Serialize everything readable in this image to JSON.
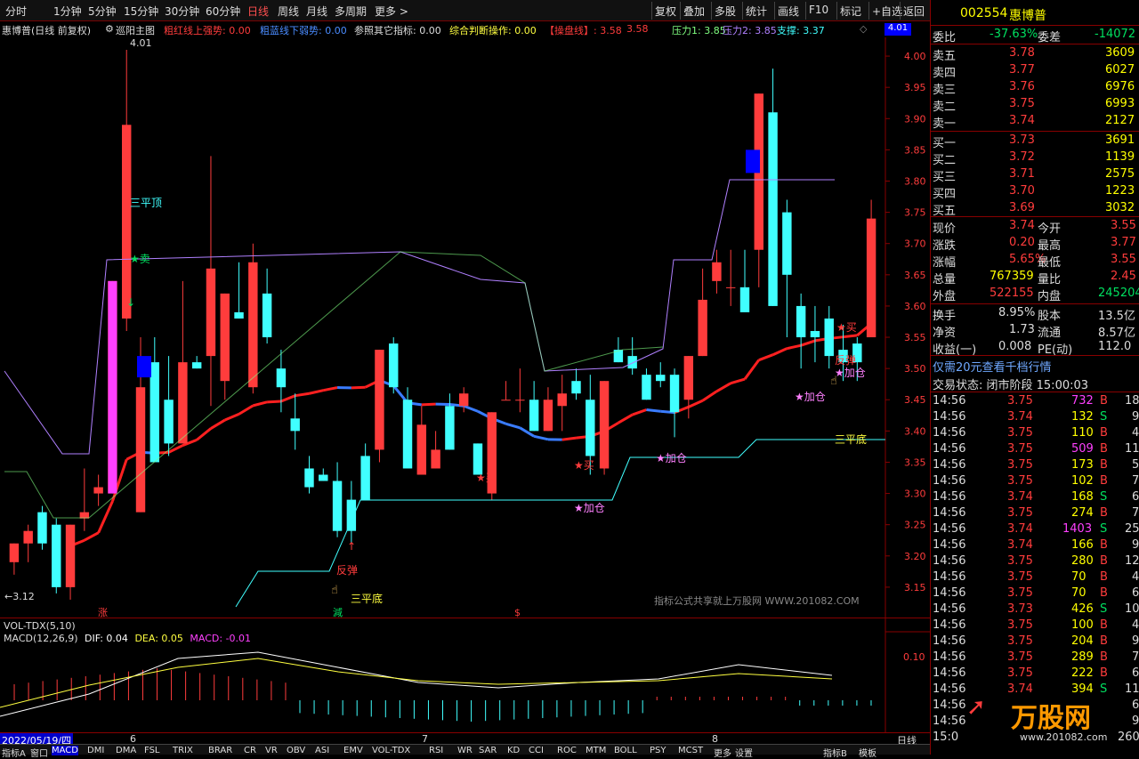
{
  "toolbar": {
    "left_items": [
      "分时",
      "1分钟",
      "5分钟",
      "15分钟",
      "30分钟",
      "60分钟",
      "日线",
      "周线",
      "月线",
      "多周期",
      "更多 >"
    ],
    "active_index": 6,
    "right_items": [
      "复权",
      "叠加",
      "多股",
      "统计",
      "画线",
      "F10",
      "标记",
      "+自选",
      "返回"
    ]
  },
  "indicator_bar": {
    "title": "惠博普(日线 前复权)",
    "main_indicator": "巡阳主图",
    "items": [
      {
        "text": "粗红线上强势: 0.00",
        "color": "#ff3c3c"
      },
      {
        "text": "粗蓝线下弱势: 0.00",
        "color": "#4a8cff"
      },
      {
        "text": "参照其它指标: 0.00",
        "color": "#dddddd"
      },
      {
        "text": "综合判断操作: 0.00",
        "color": "#ffff40"
      },
      {
        "text": "【操盘线】: 3.58",
        "color": "#ff3c3c"
      },
      {
        "text": "3.58",
        "color": "#ff3c3c"
      },
      {
        "text": "压力1: 3.85",
        "color": "#80ff80"
      },
      {
        "text": "压力2: 3.85",
        "color": "#b080ff"
      },
      {
        "text": "支撑: 3.37",
        "color": "#40ffff"
      }
    ],
    "diamond": "◇",
    "price_box": "4.01"
  },
  "price_axis": {
    "labels": [
      "4.00",
      "3.95",
      "3.90",
      "3.85",
      "3.80",
      "3.75",
      "3.70",
      "3.65",
      "3.60",
      "3.55",
      "3.50",
      "3.45",
      "3.40",
      "3.35",
      "3.30",
      "3.25",
      "3.20",
      "3.15"
    ]
  },
  "chart_annotations": {
    "high_label": "4.01",
    "low_label": "←3.12",
    "top3": "三平顶",
    "bottom3_a": "三平底",
    "bottom3_b": "三平底",
    "sell": "★卖",
    "rebound_a": "反弹",
    "rebound_b": "反弹",
    "buy_1": "★买",
    "buy_2": "★买",
    "buy_3": "★买",
    "add_1": "★加仓",
    "add_2": "★加仓",
    "add_3": "★加仓",
    "add_4": "★加仓",
    "watermark": "指标公式共享就上万股网 WWW.201082.COM",
    "mark_zhang": "涨",
    "mark_jian": "減",
    "mark_s": "$"
  },
  "sub_panel": {
    "line1": "VOL-TDX(5,10)",
    "line2_name": "MACD(12,26,9)",
    "dif": "DIF: 0.04",
    "dea": "DEA: 0.05",
    "macd": "MACD: -0.01",
    "axis_label": "0.10"
  },
  "date_axis": {
    "start_date": "2022/05/19/四",
    "months": [
      "6",
      "7",
      "8"
    ],
    "period_label": "日线"
  },
  "bottom_tabs": [
    "指标A",
    "窗口",
    "MACD",
    "DMI",
    "DMA",
    "FSL",
    "TRIX",
    "BRAR",
    "CR",
    "VR",
    "OBV",
    "ASI",
    "EMV",
    "VOL-TDX",
    "RSI",
    "WR",
    "SAR",
    "KD",
    "CCI",
    "ROC",
    "MTM",
    "BOLL",
    "PSY",
    "MCST",
    "更多",
    "设置"
  ],
  "bottom_tabs_right": [
    "指标B",
    "模板"
  ],
  "quote": {
    "code": "002554",
    "name": "惠博普",
    "weibi_label": "委比",
    "weibi": "-37.63%",
    "weicha_label": "委差",
    "weicha": "-14072",
    "asks": [
      {
        "label": "卖五",
        "price": "3.78",
        "vol": "3609"
      },
      {
        "label": "卖四",
        "price": "3.77",
        "vol": "6027"
      },
      {
        "label": "卖三",
        "price": "3.76",
        "vol": "6976"
      },
      {
        "label": "卖二",
        "price": "3.75",
        "vol": "6993"
      },
      {
        "label": "卖一",
        "price": "3.74",
        "vol": "2127"
      }
    ],
    "bids": [
      {
        "label": "买一",
        "price": "3.73",
        "vol": "3691"
      },
      {
        "label": "买二",
        "price": "3.72",
        "vol": "1139"
      },
      {
        "label": "买三",
        "price": "3.71",
        "vol": "2575"
      },
      {
        "label": "买四",
        "price": "3.70",
        "vol": "1223"
      },
      {
        "label": "买五",
        "price": "3.69",
        "vol": "3032"
      }
    ],
    "stats": [
      {
        "l1": "现价",
        "v1": "3.74",
        "c1": "red",
        "l2": "今开",
        "v2": "3.55",
        "c2": "red"
      },
      {
        "l1": "涨跌",
        "v1": "0.20",
        "c1": "red",
        "l2": "最高",
        "v2": "3.77",
        "c2": "red"
      },
      {
        "l1": "涨幅",
        "v1": "5.65%",
        "c1": "red",
        "l2": "最低",
        "v2": "3.55",
        "c2": "red"
      },
      {
        "l1": "总量",
        "v1": "767359",
        "c1": "yellow",
        "l2": "量比",
        "v2": "2.45",
        "c2": "red"
      },
      {
        "l1": "外盘",
        "v1": "522155",
        "c1": "red",
        "l2": "内盘",
        "v2": "245204",
        "c2": "green"
      }
    ],
    "stats2": [
      {
        "l1": "换手",
        "v1": "8.95%",
        "l2": "股本",
        "v2": "13.5亿"
      },
      {
        "l1": "净资",
        "v1": "1.73",
        "l2": "流通",
        "v2": "8.57亿"
      },
      {
        "l1": "收益(一)",
        "v1": "0.008",
        "l2": "PE(动)",
        "v2": "112.0"
      }
    ],
    "promo": "仅需20元查看千档行情",
    "trade_status": "交易状态: 闭市阶段 15:00:03",
    "ticks": [
      {
        "t": "14:56",
        "p": "3.75",
        "v": "732",
        "bs": "B",
        "n": "18",
        "vc": "mag"
      },
      {
        "t": "14:56",
        "p": "3.74",
        "v": "132",
        "bs": "S",
        "n": "9",
        "vc": "yellow"
      },
      {
        "t": "14:56",
        "p": "3.75",
        "v": "110",
        "bs": "B",
        "n": "4",
        "vc": "yellow"
      },
      {
        "t": "14:56",
        "p": "3.75",
        "v": "509",
        "bs": "B",
        "n": "11",
        "vc": "mag"
      },
      {
        "t": "14:56",
        "p": "3.75",
        "v": "173",
        "bs": "B",
        "n": "5",
        "vc": "yellow"
      },
      {
        "t": "14:56",
        "p": "3.75",
        "v": "102",
        "bs": "B",
        "n": "7",
        "vc": "yellow"
      },
      {
        "t": "14:56",
        "p": "3.74",
        "v": "168",
        "bs": "S",
        "n": "6",
        "vc": "yellow"
      },
      {
        "t": "14:56",
        "p": "3.75",
        "v": "274",
        "bs": "B",
        "n": "7",
        "vc": "yellow"
      },
      {
        "t": "14:56",
        "p": "3.74",
        "v": "1403",
        "bs": "S",
        "n": "25",
        "vc": "mag"
      },
      {
        "t": "14:56",
        "p": "3.74",
        "v": "166",
        "bs": "B",
        "n": "9",
        "vc": "yellow"
      },
      {
        "t": "14:56",
        "p": "3.75",
        "v": "280",
        "bs": "B",
        "n": "12",
        "vc": "yellow"
      },
      {
        "t": "14:56",
        "p": "3.75",
        "v": "70",
        "bs": "B",
        "n": "4",
        "vc": "yellow"
      },
      {
        "t": "14:56",
        "p": "3.75",
        "v": "70",
        "bs": "B",
        "n": "6",
        "vc": "yellow"
      },
      {
        "t": "14:56",
        "p": "3.73",
        "v": "426",
        "bs": "S",
        "n": "10",
        "vc": "yellow"
      },
      {
        "t": "14:56",
        "p": "3.75",
        "v": "100",
        "bs": "B",
        "n": "4",
        "vc": "yellow"
      },
      {
        "t": "14:56",
        "p": "3.75",
        "v": "204",
        "bs": "B",
        "n": "9",
        "vc": "yellow"
      },
      {
        "t": "14:56",
        "p": "3.75",
        "v": "289",
        "bs": "B",
        "n": "7",
        "vc": "yellow"
      },
      {
        "t": "14:56",
        "p": "3.75",
        "v": "222",
        "bs": "B",
        "n": "6",
        "vc": "yellow"
      },
      {
        "t": "14:56",
        "p": "3.74",
        "v": "394",
        "bs": "S",
        "n": "11",
        "vc": "yellow"
      },
      {
        "t": "14:56",
        "p": "",
        "v": "",
        "bs": "",
        "n": "6",
        "vc": "yellow"
      },
      {
        "t": "14:56",
        "p": "",
        "v": "",
        "bs": "",
        "n": "9",
        "vc": "yellow"
      },
      {
        "t": "15:0",
        "p": "",
        "v": "",
        "bs": "",
        "n": "260",
        "vc": "yellow"
      }
    ],
    "logo_text": "万股网",
    "logo_url": "www.201082.com"
  },
  "colors": {
    "up": "#ff3c3c",
    "down": "#40ffff",
    "ma_up": "#ff2020",
    "ma_down": "#3a7cff",
    "accent_red": "#ff3c3c",
    "green": "#00e060",
    "yellow": "#ffff00"
  },
  "chart_data": {
    "type": "candlestick",
    "ylim": [
      3.1,
      4.03
    ],
    "candles": [
      {
        "o": 3.19,
        "h": 3.22,
        "l": 3.17,
        "c": 3.22
      },
      {
        "o": 3.22,
        "h": 3.25,
        "l": 3.19,
        "c": 3.24
      },
      {
        "o": 3.27,
        "h": 3.28,
        "l": 3.21,
        "c": 3.22
      },
      {
        "o": 3.25,
        "h": 3.26,
        "l": 3.14,
        "c": 3.15
      },
      {
        "o": 3.15,
        "h": 3.25,
        "l": 3.13,
        "c": 3.25
      },
      {
        "o": 3.26,
        "h": 3.34,
        "l": 3.24,
        "c": 3.27
      },
      {
        "o": 3.3,
        "h": 3.33,
        "l": 3.28,
        "c": 3.31
      },
      {
        "o": 3.3,
        "h": 3.64,
        "l": 3.3,
        "c": 3.64
      },
      {
        "o": 3.58,
        "h": 4.01,
        "l": 3.56,
        "c": 3.89
      },
      {
        "o": 3.27,
        "h": 3.55,
        "l": 3.27,
        "c": 3.47
      },
      {
        "o": 3.51,
        "h": 3.55,
        "l": 3.35,
        "c": 3.35
      },
      {
        "o": 3.45,
        "h": 3.52,
        "l": 3.36,
        "c": 3.38
      },
      {
        "o": 3.38,
        "h": 3.64,
        "l": 3.38,
        "c": 3.51
      },
      {
        "o": 3.51,
        "h": 3.52,
        "l": 3.5,
        "c": 3.5
      },
      {
        "o": 3.52,
        "h": 3.84,
        "l": 3.44,
        "c": 3.66
      },
      {
        "o": 3.48,
        "h": 3.62,
        "l": 3.45,
        "c": 3.62
      },
      {
        "o": 3.59,
        "h": 3.67,
        "l": 3.58,
        "c": 3.58
      },
      {
        "o": 3.47,
        "h": 3.7,
        "l": 3.46,
        "c": 3.67
      },
      {
        "o": 3.62,
        "h": 3.66,
        "l": 3.54,
        "c": 3.55
      },
      {
        "o": 3.5,
        "h": 3.53,
        "l": 3.43,
        "c": 3.47
      },
      {
        "o": 3.42,
        "h": 3.46,
        "l": 3.37,
        "c": 3.4
      },
      {
        "o": 3.34,
        "h": 3.36,
        "l": 3.3,
        "c": 3.31
      },
      {
        "o": 3.33,
        "h": 3.34,
        "l": 3.32,
        "c": 3.32
      },
      {
        "o": 3.32,
        "h": 3.35,
        "l": 3.23,
        "c": 3.24
      },
      {
        "o": 3.29,
        "h": 3.32,
        "l": 3.22,
        "c": 3.24
      },
      {
        "o": 3.36,
        "h": 3.38,
        "l": 3.29,
        "c": 3.29
      },
      {
        "o": 3.37,
        "h": 3.53,
        "l": 3.35,
        "c": 3.53
      },
      {
        "o": 3.54,
        "h": 3.55,
        "l": 3.46,
        "c": 3.47
      },
      {
        "o": 3.45,
        "h": 3.47,
        "l": 3.34,
        "c": 3.34
      },
      {
        "o": 3.33,
        "h": 3.44,
        "l": 3.33,
        "c": 3.41
      },
      {
        "o": 3.34,
        "h": 3.4,
        "l": 3.34,
        "c": 3.37
      },
      {
        "o": 3.44,
        "h": 3.46,
        "l": 3.37,
        "c": 3.37
      },
      {
        "o": 3.44,
        "h": 3.47,
        "l": 3.43,
        "c": 3.46
      },
      {
        "o": 3.38,
        "h": 3.38,
        "l": 3.33,
        "c": 3.33
      },
      {
        "o": 3.3,
        "h": 3.43,
        "l": 3.29,
        "c": 3.43
      },
      {
        "o": 3.45,
        "h": 3.48,
        "l": 3.45,
        "c": 3.45
      },
      {
        "o": 3.45,
        "h": 3.5,
        "l": 3.43,
        "c": 3.45
      },
      {
        "o": 3.45,
        "h": 3.48,
        "l": 3.4,
        "c": 3.4
      },
      {
        "o": 3.4,
        "h": 3.47,
        "l": 3.4,
        "c": 3.45
      },
      {
        "o": 3.44,
        "h": 3.49,
        "l": 3.4,
        "c": 3.46
      },
      {
        "o": 3.48,
        "h": 3.5,
        "l": 3.45,
        "c": 3.46
      },
      {
        "o": 3.45,
        "h": 3.49,
        "l": 3.33,
        "c": 3.36
      },
      {
        "o": 3.34,
        "h": 3.48,
        "l": 3.33,
        "c": 3.48
      },
      {
        "o": 3.53,
        "h": 3.55,
        "l": 3.51,
        "c": 3.51
      },
      {
        "o": 3.52,
        "h": 3.55,
        "l": 3.49,
        "c": 3.5
      },
      {
        "o": 3.49,
        "h": 3.5,
        "l": 3.45,
        "c": 3.45
      },
      {
        "o": 3.49,
        "h": 3.51,
        "l": 3.47,
        "c": 3.48
      },
      {
        "o": 3.49,
        "h": 3.5,
        "l": 3.39,
        "c": 3.43
      },
      {
        "o": 3.45,
        "h": 3.52,
        "l": 3.42,
        "c": 3.52
      },
      {
        "o": 3.52,
        "h": 3.66,
        "l": 3.52,
        "c": 3.61
      },
      {
        "o": 3.64,
        "h": 3.69,
        "l": 3.62,
        "c": 3.67
      },
      {
        "o": 3.63,
        "h": 3.69,
        "l": 3.6,
        "c": 3.63
      },
      {
        "o": 3.63,
        "h": 3.69,
        "l": 3.59,
        "c": 3.59
      },
      {
        "o": 3.69,
        "h": 3.94,
        "l": 3.63,
        "c": 3.94
      },
      {
        "o": 3.91,
        "h": 3.98,
        "l": 3.6,
        "c": 3.6
      },
      {
        "o": 3.75,
        "h": 3.77,
        "l": 3.55,
        "c": 3.65
      },
      {
        "o": 3.6,
        "h": 3.62,
        "l": 3.5,
        "c": 3.55
      },
      {
        "o": 3.56,
        "h": 3.6,
        "l": 3.51,
        "c": 3.55
      },
      {
        "o": 3.58,
        "h": 3.6,
        "l": 3.5,
        "c": 3.52
      },
      {
        "o": 3.53,
        "h": 3.57,
        "l": 3.48,
        "c": 3.51
      },
      {
        "o": 3.54,
        "h": 3.55,
        "l": 3.48,
        "c": 3.51
      },
      {
        "o": 3.55,
        "h": 3.77,
        "l": 3.55,
        "c": 3.74
      }
    ]
  }
}
